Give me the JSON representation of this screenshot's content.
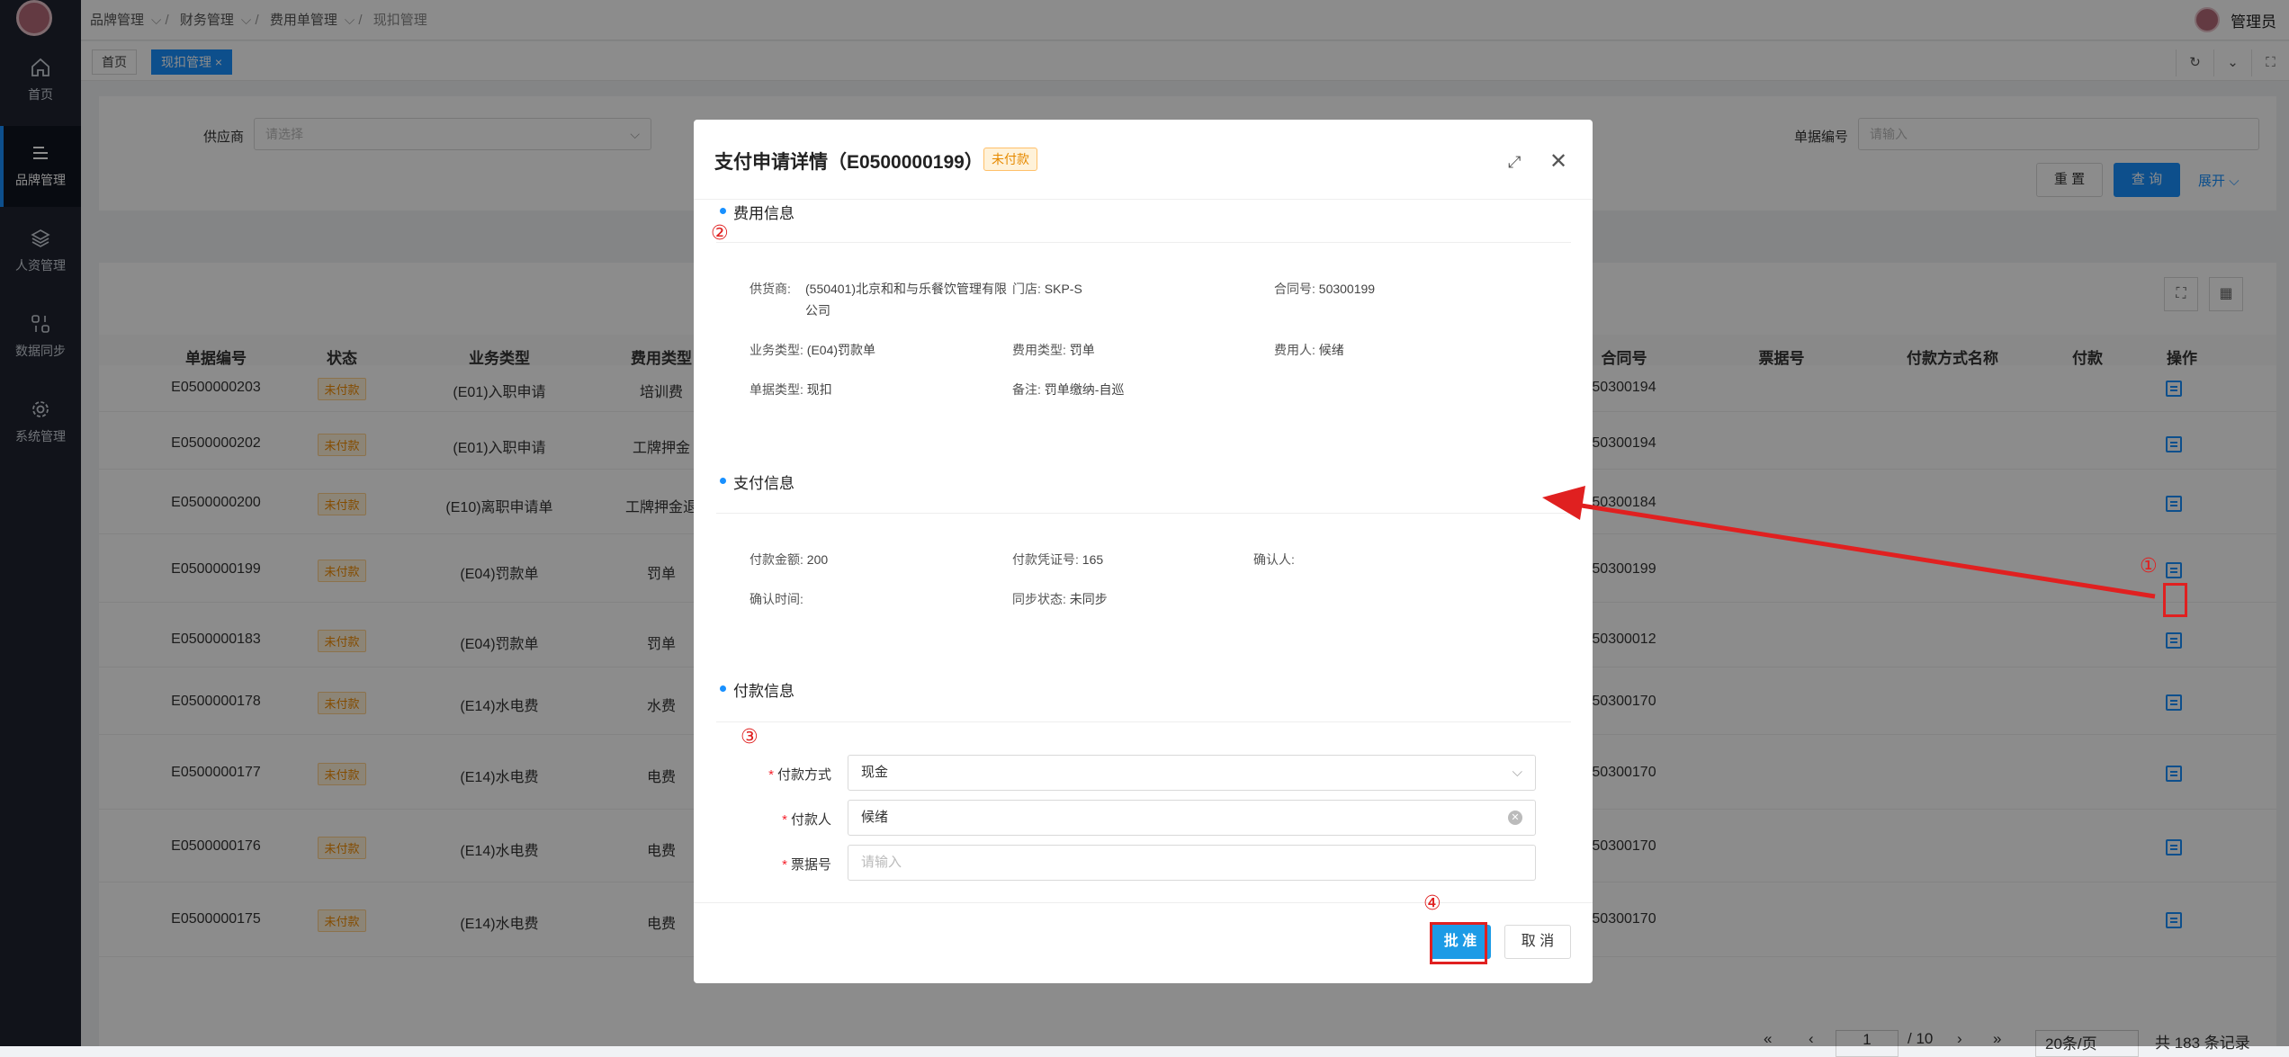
{
  "header": {
    "breadcrumbs": [
      "品牌管理",
      "财务管理",
      "费用单管理"
    ],
    "current": "现扣管理",
    "user": "管理员"
  },
  "sidebar": {
    "items": [
      {
        "label": "首页",
        "icon": "home-icon"
      },
      {
        "label": "品牌管理",
        "icon": "list-icon",
        "active": true
      },
      {
        "label": "人资管理",
        "icon": "layers-icon"
      },
      {
        "label": "数据同步",
        "icon": "sync-icon"
      },
      {
        "label": "系统管理",
        "icon": "gear-icon"
      }
    ]
  },
  "tabs": [
    {
      "label": "首页"
    },
    {
      "label": "现扣管理 ×",
      "active": true
    }
  ],
  "filter": {
    "supplier_label": "供应商",
    "supplier_placeholder": "请选择",
    "doc_label": "单据编号",
    "doc_placeholder": "请输入",
    "reset": "重 置",
    "query": "查 询",
    "expand": "展开"
  },
  "table": {
    "columns": [
      "单据编号",
      "状态",
      "业务类型",
      "费用类型",
      "合同号",
      "票据号",
      "付款方式名称",
      "付款",
      "操作"
    ],
    "rows": [
      {
        "id": "E0500000203",
        "status": "未付款",
        "biz": "(E01)入职申请",
        "fee": "培训费",
        "contract": "50300194"
      },
      {
        "id": "E0500000202",
        "status": "未付款",
        "biz": "(E01)入职申请",
        "fee": "工牌押金",
        "contract": "50300194"
      },
      {
        "id": "E0500000200",
        "status": "未付款",
        "biz": "(E10)离职申请单",
        "fee": "工牌押金退",
        "contract": "50300184"
      },
      {
        "id": "E0500000199",
        "status": "未付款",
        "biz": "(E04)罚款单",
        "fee": "罚单",
        "contract": "50300199"
      },
      {
        "id": "E0500000183",
        "status": "未付款",
        "biz": "(E04)罚款单",
        "fee": "罚单",
        "contract": "50300012"
      },
      {
        "id": "E0500000178",
        "status": "未付款",
        "biz": "(E14)水电费",
        "fee": "水费",
        "contract": "50300170"
      },
      {
        "id": "E0500000177",
        "status": "未付款",
        "biz": "(E14)水电费",
        "fee": "电费",
        "contract": "50300170"
      },
      {
        "id": "E0500000176",
        "status": "未付款",
        "biz": "(E14)水电费",
        "fee": "电费",
        "contract": "50300170"
      },
      {
        "id": "E0500000175",
        "status": "未付款",
        "biz": "(E14)水电费",
        "fee": "电费",
        "contract": "50300170"
      }
    ]
  },
  "pager": {
    "page": "1",
    "total_pages": "/ 10",
    "page_size": "20条/页",
    "total": "共 183 条记录"
  },
  "modal": {
    "title": "支付申请详情（E0500000199）",
    "badge": "未付款",
    "fee_section": "费用信息",
    "fee": {
      "supplier_k": "供货商:",
      "supplier_v": "(550401)北京和和与乐餐饮管理有限公司",
      "store_k": "门店:",
      "store_v": "SKP-S",
      "contract_k": "合同号:",
      "contract_v": "50300199",
      "biz_k": "业务类型:",
      "biz_v": "(E04)罚款单",
      "feetype_k": "费用类型:",
      "feetype_v": "罚单",
      "payer_k": "费用人:",
      "payer_v": "候绪",
      "doctype_k": "单据类型:",
      "doctype_v": "现扣",
      "remark_k": "备注:",
      "remark_v": "罚单缴纳-自巡"
    },
    "pay_section": "支付信息",
    "pay": {
      "amount_k": "付款金额:",
      "amount_v": "200",
      "voucher_k": "付款凭证号:",
      "voucher_v": "165",
      "confirmer_k": "确认人:",
      "confirmer_v": "",
      "time_k": "确认时间:",
      "time_v": "",
      "sync_k": "同步状态:",
      "sync_v": "未同步"
    },
    "payment_section": "付款信息",
    "form": {
      "method_label": "付款方式",
      "method_value": "现金",
      "payer_label": "付款人",
      "payer_value": "候绪",
      "invoice_label": "票据号",
      "invoice_placeholder": "请输入"
    },
    "approve": "批 准",
    "cancel": "取 消"
  },
  "annotations": [
    "①",
    "②",
    "③",
    "④"
  ],
  "colors": {
    "primary": "#1890ff",
    "annotation": "#e02020",
    "sidebar": "#1f2430"
  }
}
